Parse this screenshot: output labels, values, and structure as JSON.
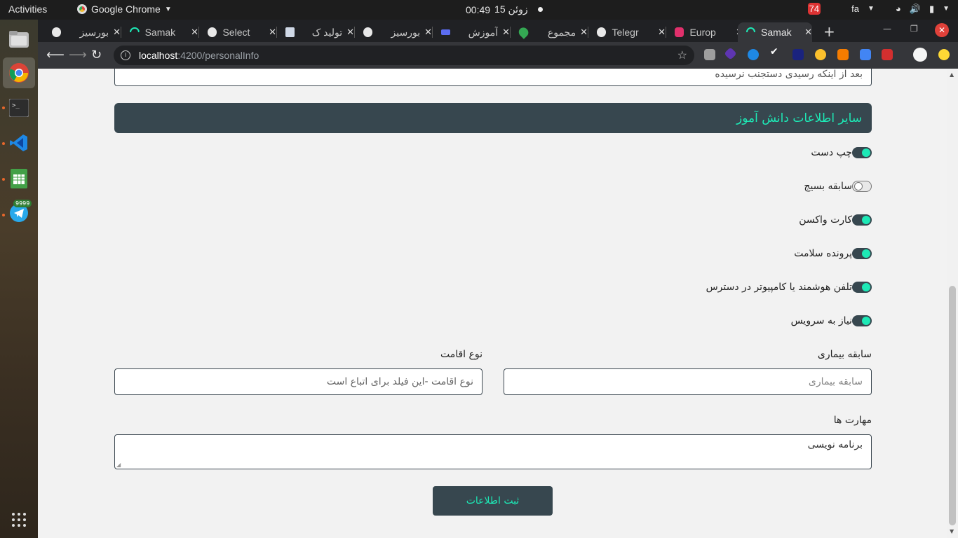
{
  "topbar": {
    "activities": "Activities",
    "app_name": "Google Chrome",
    "date_time": "00:49 زوئن 15",
    "time": "00:49",
    "date": "زوئن 15",
    "language": "fa",
    "badge": "74"
  },
  "dock": {
    "telegram_badge": "9999"
  },
  "tabs": [
    {
      "label": "بورسیز",
      "favicon_color": "#e8e8e8"
    },
    {
      "label": "Samak",
      "favicon_color": "#1de9b6"
    },
    {
      "label": "Select",
      "favicon_color": "#e8e8e8"
    },
    {
      "label": "تولید ک",
      "favicon_color": "#cfd8e6"
    },
    {
      "label": "بورسیز",
      "favicon_color": "#e8e8e8"
    },
    {
      "label": "آموزش",
      "favicon_color": "#5b6cf0"
    },
    {
      "label": "مجموع",
      "favicon_color": "#34a853"
    },
    {
      "label": "Telegr",
      "favicon_color": "#e8e8e8"
    },
    {
      "label": "Europ",
      "favicon_color": "#e1306c"
    },
    {
      "label": "Samak",
      "favicon_color": "#1de9b6"
    }
  ],
  "toolbar": {
    "url_host": "localhost",
    "url_path": ":4200/personalInfo"
  },
  "form": {
    "top_field_value": "بعد از اینکه رسیدی دستجنب نرسیده",
    "section_title": "سایر اطلاعات دانش آموز",
    "toggles": [
      {
        "label": "چپ دست",
        "on": true
      },
      {
        "label": "سابقه بسیج",
        "on": false
      },
      {
        "label": "کارت واکسن",
        "on": true
      },
      {
        "label": "پرونده سلامت",
        "on": true
      },
      {
        "label": "تلفن هوشمند یا کامپیوتر در دسترس",
        "on": true
      },
      {
        "label": "نیاز به سرویس",
        "on": true
      }
    ],
    "disease_label": "سابقه بیماری",
    "disease_placeholder": "سابقه بیماری",
    "residence_label": "نوع اقامت",
    "residence_placeholder": "نوع اقامت -این فیلد برای اتباع است",
    "skills_label": "مهارت ها",
    "skills_value": "برنامه نویسی",
    "submit_label": "ثبت اطلاعات"
  },
  "colors": {
    "header_bg": "#37474f",
    "accent": "#1de9b6",
    "page_bg": "#f2f2f2"
  }
}
